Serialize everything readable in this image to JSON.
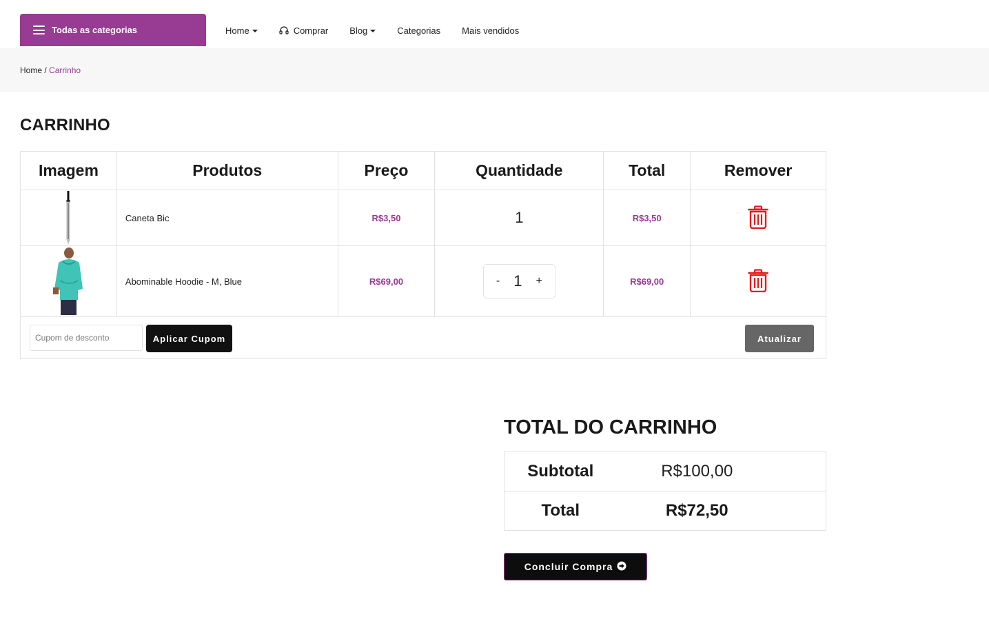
{
  "nav": {
    "categories_label": "Todas as categorias",
    "items": [
      {
        "label": "Home",
        "dropdown": true
      },
      {
        "label": "Comprar",
        "icon": "headset-icon"
      },
      {
        "label": "Blog",
        "dropdown": true
      },
      {
        "label": "Categorias"
      },
      {
        "label": "Mais vendidos"
      }
    ]
  },
  "breadcrumb": {
    "home": "Home",
    "separator": " / ",
    "current": "Carrinho"
  },
  "page_title": "CARRINHO",
  "cart": {
    "headers": [
      "Imagem",
      "Produtos",
      "Preço",
      "Quantidade",
      "Total",
      "Remover"
    ],
    "rows": [
      {
        "image": "pen-image",
        "name": "Caneta Bic",
        "price": "R$3,50",
        "quantity": "1",
        "total": "R$3,50"
      },
      {
        "image": "hoodie-image",
        "name": "Abominable Hoodie - M, Blue",
        "price": "R$69,00",
        "quantity": "1",
        "minus": "-",
        "plus": "+",
        "total": "R$69,00"
      }
    ],
    "coupon_placeholder": "Cupom de desconto",
    "apply_label": "Aplicar Cupom",
    "update_label": "Atualizar"
  },
  "totals": {
    "title": "TOTAL DO CARRINHO",
    "subtotal_label": "Subtotal",
    "subtotal_value": "R$100,00",
    "total_label": "Total",
    "total_value": "R$72,50"
  },
  "checkout_label": "Concluir Compra",
  "colors": {
    "brand": "#973b93",
    "danger": "#e31b1b",
    "dark": "#111111"
  }
}
